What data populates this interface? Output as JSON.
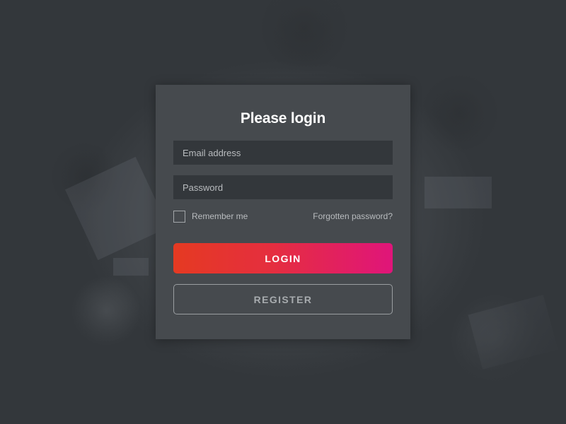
{
  "login_form": {
    "title": "Please login",
    "email_placeholder": "Email address",
    "password_placeholder": "Password",
    "remember_label": "Remember me",
    "remember_checked": false,
    "forgot_link": "Forgotten password?",
    "login_button": "LOGIN",
    "register_button": "REGISTER"
  },
  "colors": {
    "background": "#33373b",
    "card": "#464a4e",
    "field": "#33373b",
    "login_gradient_start": "#e53a22",
    "login_gradient_end": "#e0157a"
  }
}
